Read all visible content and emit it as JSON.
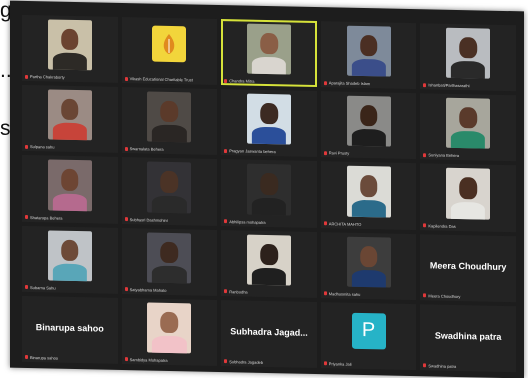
{
  "side_text": [
    "g",
    "...",
    "s"
  ],
  "meeting": {
    "participants": [
      {
        "name": "Partha Chakraborty",
        "type": "video",
        "bg": "#c9c0a8",
        "skin": "#6b4330",
        "shirt": "#2d2a26"
      },
      {
        "name": "Vikash Educational Charitable Trust",
        "type": "logo"
      },
      {
        "name": "Chandra Mitra",
        "type": "video",
        "bg": "#9aa08a",
        "skin": "#8a5e46",
        "shirt": "#d9d5cf",
        "active": true
      },
      {
        "name": "Aparajita Shadeb Islam",
        "type": "video",
        "bg": "#7e8a9a",
        "skin": "#4b2f23",
        "shirt": "#3b4e8a"
      },
      {
        "name": "Ishanbati/Parthasarathi",
        "type": "video",
        "bg": "#b9bcc0",
        "skin": "#4a3024",
        "shirt": "#2a2a2a"
      },
      {
        "name": "Sulpana sahu",
        "type": "video",
        "bg": "#9b8b84",
        "skin": "#6a4634",
        "shirt": "#c7443a"
      },
      {
        "name": "Swarnalata Behera",
        "type": "video",
        "bg": "#4f4a46",
        "skin": "#5b3a2a",
        "shirt": "#2a2624"
      },
      {
        "name": "Pragyan Jaswanta behera",
        "type": "video",
        "bg": "#d2dde5",
        "skin": "#3c2a22",
        "shirt": "#2b4f9a"
      },
      {
        "name": "Ravi Prusty",
        "type": "video",
        "bg": "#8a8a88",
        "skin": "#3a2519",
        "shirt": "#1e1e1e"
      },
      {
        "name": "Suniyana Behera",
        "type": "video",
        "bg": "#a7a69c",
        "skin": "#5a3a2b",
        "shirt": "#2a8a6a"
      },
      {
        "name": "Shatarupa Behera",
        "type": "video",
        "bg": "#7a6a6a",
        "skin": "#6d4533",
        "shirt": "#b56a8e"
      },
      {
        "name": "Subhasri Dashmohini",
        "type": "video",
        "bg": "#333236",
        "skin": "#4b3326",
        "shirt": "#2a2a2a"
      },
      {
        "name": "Abhilipsa mohapatra",
        "type": "video",
        "bg": "#2e2e2e",
        "skin": "#3a2a20",
        "shirt": "#222"
      },
      {
        "name": "ARCHITA MAHTO",
        "type": "video",
        "bg": "#dbdbd6",
        "skin": "#6b4b3b",
        "shirt": "#2b6b8a"
      },
      {
        "name": "Kapilendra Das",
        "type": "video",
        "bg": "#d8d4ce",
        "skin": "#4a2f22",
        "shirt": "#e6e6e2"
      },
      {
        "name": "Subarna Sahu",
        "type": "video",
        "bg": "#bfc3c7",
        "skin": "#6d4a38",
        "shirt": "#59a6b8"
      },
      {
        "name": "Satyabhama Mahato",
        "type": "video",
        "bg": "#4d4d55",
        "skin": "#3e2a20",
        "shirt": "#2d2d2d"
      },
      {
        "name": "Ranbudha",
        "type": "video",
        "bg": "#d7d2c8",
        "skin": "#2d211b",
        "shirt": "#1f1f1f"
      },
      {
        "name": "Madhusmita sahu",
        "type": "video",
        "bg": "#3d3d3d",
        "skin": "#6a4634",
        "shirt": "#1e3a6e"
      },
      {
        "name": "Meera Choudhury",
        "type": "name",
        "display": "Meera Choudhury"
      },
      {
        "name": "Binarupa sahoo",
        "type": "name",
        "display": "Binarupa sahoo"
      },
      {
        "name": "Sambidya Mohapatra",
        "type": "video",
        "bg": "#e8d4c8",
        "skin": "#9a6b52",
        "shirt": "#f2c2c8"
      },
      {
        "name": "Subhadra Jagadeb",
        "type": "name",
        "display": "Subhadra Jagad..."
      },
      {
        "name": "Priyanka Jali",
        "type": "letter",
        "letter": "P"
      },
      {
        "name": "Swadhina patra",
        "type": "name",
        "display": "Swadhina patra"
      }
    ]
  },
  "colors": {
    "active_border": "#d6e23a",
    "muted_mic": "#e0383a",
    "letter_avatar": "#26b3c7"
  }
}
